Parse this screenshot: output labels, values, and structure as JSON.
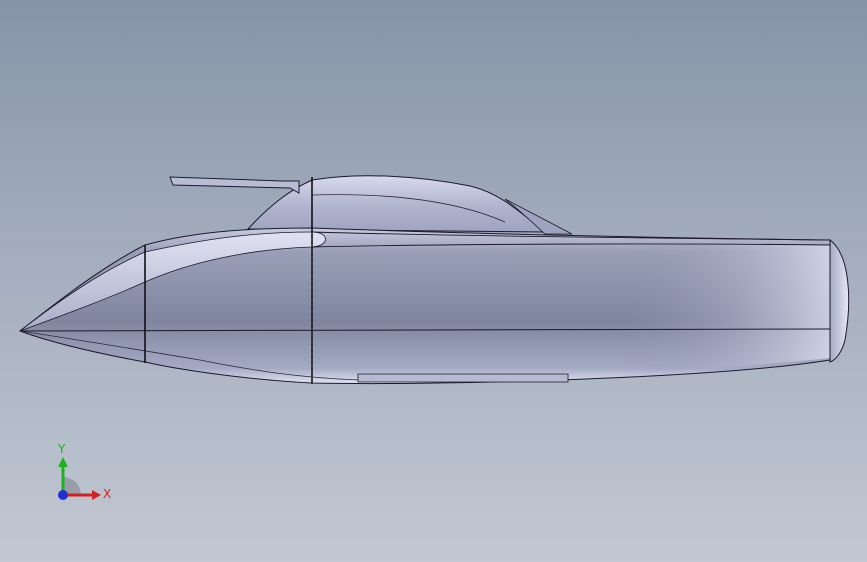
{
  "viewport": {
    "background_top": "#8794a8",
    "background_bottom": "#c2c8d3"
  },
  "model": {
    "name": "boat-hull",
    "edge_color": "#1a1a2a",
    "body_color": "#8a90aa"
  },
  "triad": {
    "x_label": "X",
    "y_label": "Y",
    "x_color": "#d42020",
    "y_color": "#20b020",
    "z_color": "#2030d0"
  }
}
